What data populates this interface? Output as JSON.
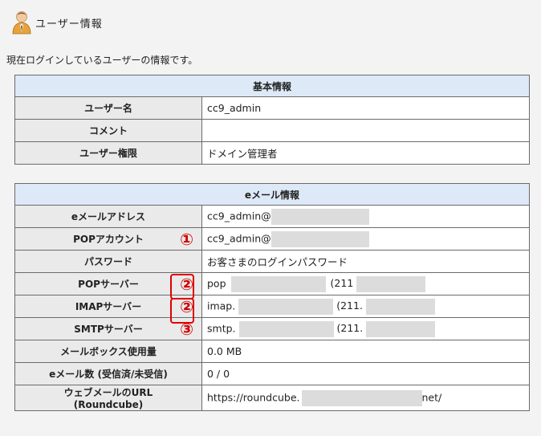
{
  "header": {
    "title": "ユーザー情報",
    "icon": "user-icon"
  },
  "description": "現在ログインしているユーザーの情報です。",
  "basic": {
    "title": "基本情報",
    "rows": [
      {
        "label": "ユーザー名",
        "value": "cc9_admin"
      },
      {
        "label": "コメント",
        "value": ""
      },
      {
        "label": "ユーザー権限",
        "value": "ドメイン管理者"
      }
    ]
  },
  "email": {
    "title": "eメール情報",
    "rows": [
      {
        "label": "eメールアドレス",
        "value": "cc9_admin@"
      },
      {
        "label": "POPアカウント",
        "value": "cc9_admin@",
        "marker": "①"
      },
      {
        "label": "パスワード",
        "value": "お客さまのログインパスワード"
      },
      {
        "label": "POPサーバー",
        "value_a": "pop",
        "value_b": "(211",
        "marker": "②"
      },
      {
        "label": "IMAPサーバー",
        "value_a": "imap.",
        "value_b": "(211.",
        "marker": "②"
      },
      {
        "label": "SMTPサーバー",
        "value_a": "smtp.",
        "value_b": "(211.",
        "marker": "③"
      },
      {
        "label": "メールボックス使用量",
        "value": "0.0 MB"
      },
      {
        "label": "eメール数 (受信済/未受信)",
        "value": "0 / 0"
      },
      {
        "label_line1": "ウェブメールのURL",
        "label_line2": "(Roundcube)",
        "value_a": "https://roundcube.",
        "value_b": "net/"
      }
    ]
  },
  "colors": {
    "section_header": "#dde9f6",
    "label_bg": "#eaeaea",
    "marker": "#e00000",
    "redaction": "#dcdcdc"
  }
}
